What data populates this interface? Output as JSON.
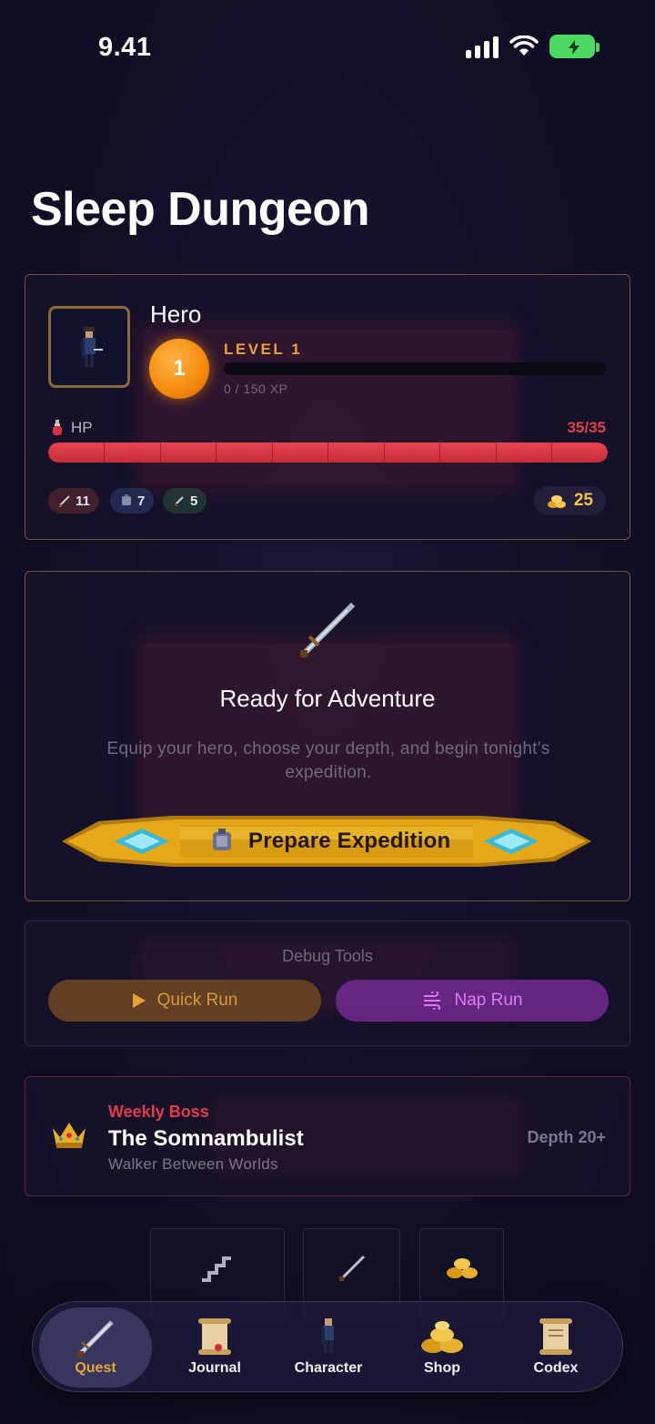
{
  "status_bar": {
    "time": "9.41"
  },
  "page": {
    "title": "Sleep Dungeon"
  },
  "hero": {
    "name": "Hero",
    "level_number": "1",
    "level_label": "LEVEL 1",
    "xp_text": "0 / 150 XP",
    "xp_progress": 0,
    "hp_label": "HP",
    "hp_value": "35/35",
    "hp_progress": 1.0,
    "stats": {
      "attack": "11",
      "defense": "7",
      "agility": "5"
    },
    "gold": "25"
  },
  "adventure": {
    "title": "Ready for Adventure",
    "description": "Equip your hero, choose your depth, and begin tonight's expedition.",
    "button_label": "Prepare Expedition"
  },
  "debug": {
    "title": "Debug Tools",
    "quick_run": "Quick Run",
    "nap_run": "Nap Run"
  },
  "boss": {
    "kicker": "Weekly Boss",
    "name": "The Somnambulist",
    "subtitle": "Walker Between Worlds",
    "depth": "Depth 20+"
  },
  "tabs": [
    {
      "label": "Quest",
      "icon": "sword-icon",
      "active": true
    },
    {
      "label": "Journal",
      "icon": "scroll-icon",
      "active": false
    },
    {
      "label": "Character",
      "icon": "character-icon",
      "active": false
    },
    {
      "label": "Shop",
      "icon": "gold-pile-icon",
      "active": false
    },
    {
      "label": "Codex",
      "icon": "codex-scroll-icon",
      "active": false
    }
  ],
  "colors": {
    "accent_gold": "#e6a23c",
    "hp_red": "#e0404a",
    "nap_purple": "#d87cf0",
    "boss_red": "#e03c4e"
  }
}
